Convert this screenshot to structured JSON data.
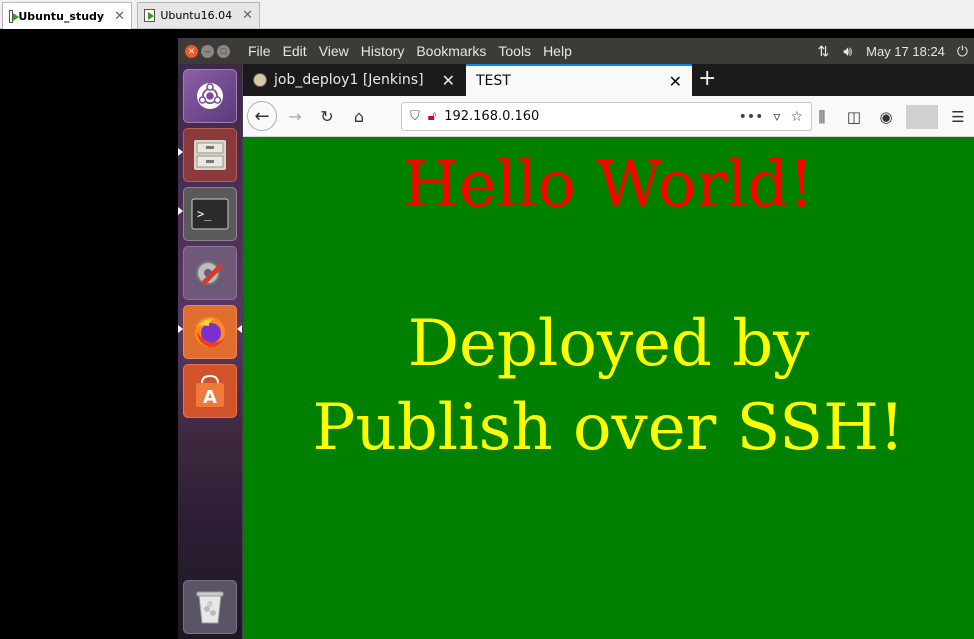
{
  "vm": {
    "tabs": [
      {
        "label": "Ubuntu_study"
      },
      {
        "label": "Ubuntu16.04"
      }
    ]
  },
  "panel": {
    "menus": [
      "File",
      "Edit",
      "View",
      "History",
      "Bookmarks",
      "Tools",
      "Help"
    ],
    "clock": "May 17 18:24"
  },
  "launcher": {
    "items": [
      "ubuntu-dash",
      "files",
      "terminal",
      "system-settings",
      "firefox",
      "software-center",
      "trash"
    ]
  },
  "browser": {
    "tabs": [
      {
        "label": "job_deploy1 [Jenkins]"
      },
      {
        "label": "TEST"
      }
    ],
    "url": "192.168.0.160"
  },
  "page": {
    "heading": "Hello World!",
    "message_line1": "Deployed by",
    "message_line2": "Publish over SSH!",
    "background": "#008000",
    "heading_color": "#ff0000",
    "message_color": "#ffff00"
  }
}
